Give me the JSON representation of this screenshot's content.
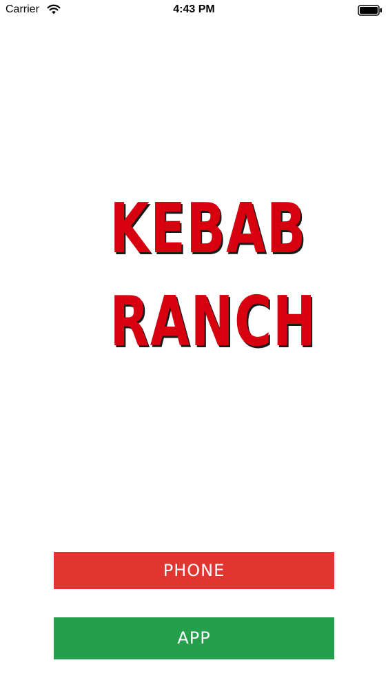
{
  "status_bar": {
    "carrier": "Carrier",
    "time": "4:43 PM",
    "wifi_icon": "wifi-icon",
    "battery_icon": "battery-icon"
  },
  "logo": {
    "line1": "KEBAB",
    "line2": "RANCH",
    "color": "#d7000f"
  },
  "buttons": {
    "phone_label": "PHONE",
    "phone_color": "#e03530",
    "app_label": "APP",
    "app_color": "#24a04c"
  }
}
